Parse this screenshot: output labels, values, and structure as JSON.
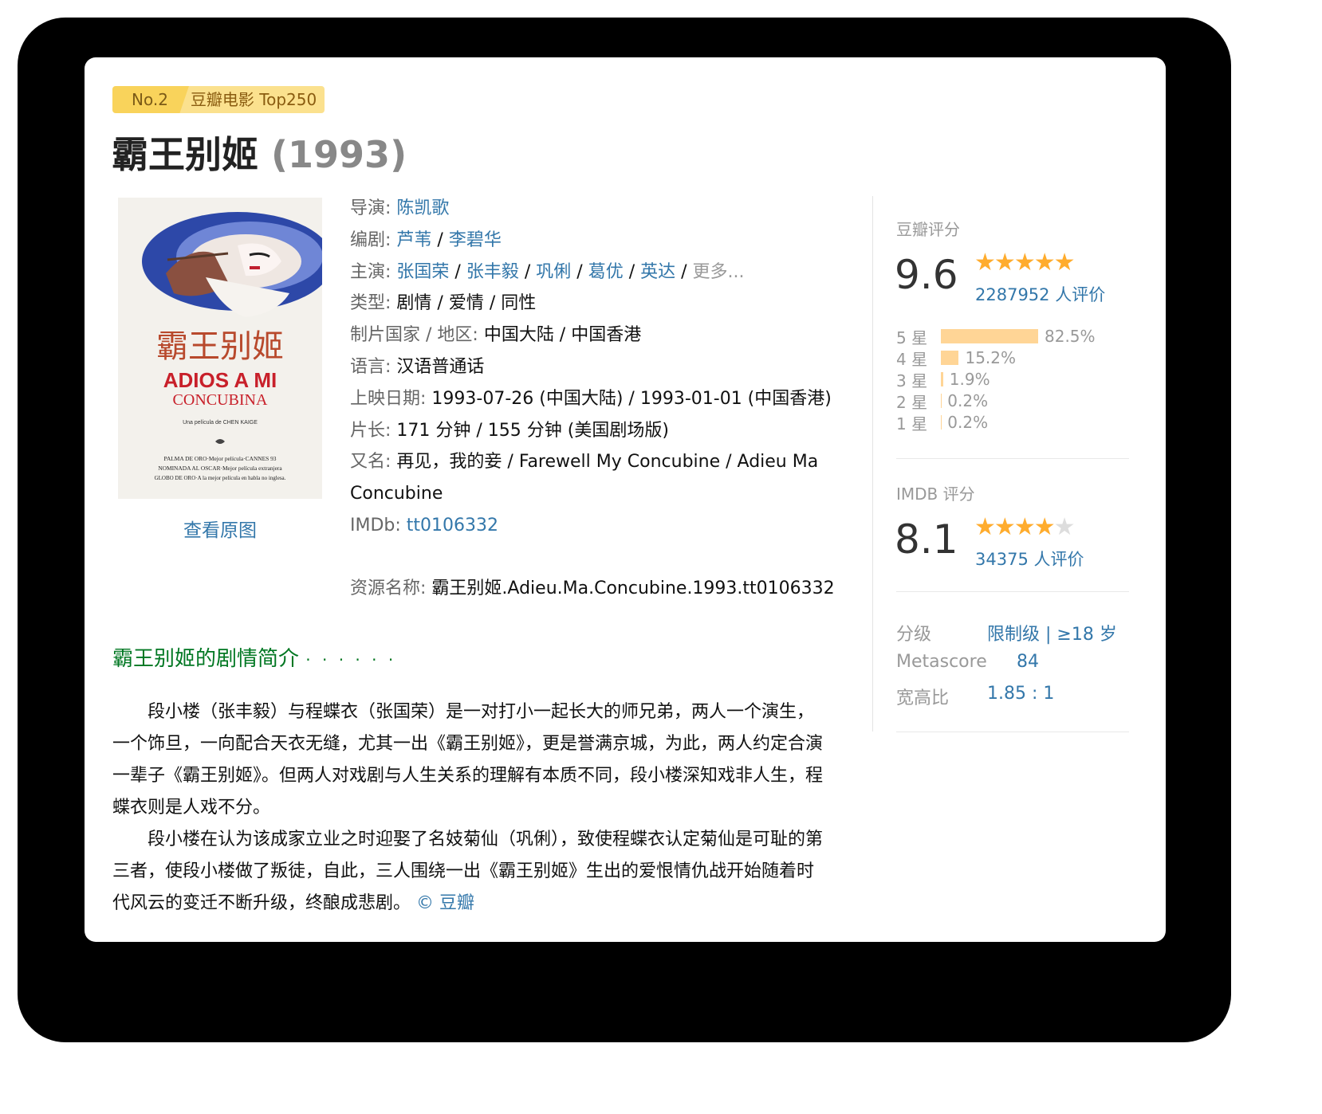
{
  "badge": {
    "rank": "No.2",
    "list": "豆瓣电影 Top250"
  },
  "title": {
    "name": "霸王别姬",
    "year": "(1993)"
  },
  "poster": {
    "chinese_title": "霸王别姬",
    "line1": "ADIOS A MI",
    "line2": "CONCUBINA",
    "credit": "Una película de CHEN KAIGE",
    "award1": "PALMA DE ORO·Mejor película·CANNES 93",
    "award2": "NOMINADA AL OSCAR·Mejor película extranjera",
    "award3": "GLOBO DE ORO·A la mejor película en habla no inglesa.",
    "view_link": "查看原图"
  },
  "info": {
    "director_label": "导演",
    "director": "陈凯歌",
    "writer_label": "编剧",
    "writers": [
      "芦苇",
      "李碧华"
    ],
    "cast_label": "主演",
    "cast": [
      "张国荣",
      "张丰毅",
      "巩俐",
      "葛优",
      "英达"
    ],
    "cast_more": "更多...",
    "genre_label": "类型",
    "genre": "剧情 / 爱情 / 同性",
    "country_label": "制片国家 / 地区",
    "country": "中国大陆 / 中国香港",
    "language_label": "语言",
    "language": "汉语普通话",
    "release_label": "上映日期",
    "release": "1993-07-26 (中国大陆) / 1993-01-01 (中国香港)",
    "runtime_label": "片长",
    "runtime": "171 分钟 / 155 分钟 (美国剧场版)",
    "aka_label": "又名",
    "aka": "再见，我的妾 / Farewell My Concubine / Adieu Ma Concubine",
    "imdb_label": "IMDb",
    "imdb_id": "tt0106332",
    "resource_label": "资源名称",
    "resource": "霸王别姬.Adieu.Ma.Concubine.1993.tt0106332"
  },
  "douban_rating": {
    "heading": "豆瓣评分",
    "score": "9.6",
    "stars": 5,
    "votes": "2287952 人评价",
    "distribution": [
      {
        "label": "5 星",
        "percent": 82.5,
        "text": "82.5%"
      },
      {
        "label": "4 星",
        "percent": 15.2,
        "text": "15.2%"
      },
      {
        "label": "3 星",
        "percent": 1.9,
        "text": "1.9%"
      },
      {
        "label": "2 星",
        "percent": 0.2,
        "text": "0.2%"
      },
      {
        "label": "1 星",
        "percent": 0.2,
        "text": "0.2%"
      }
    ]
  },
  "imdb_rating": {
    "heading": "IMDB 评分",
    "score": "8.1",
    "stars": 4,
    "votes": "34375 人评价"
  },
  "extra": {
    "rating_label": "分级",
    "rating_value": "限制级 | ≥18 岁",
    "metascore_label": "Metascore",
    "metascore_value": "84",
    "aspect_label": "宽高比",
    "aspect_value": "1.85 : 1"
  },
  "summary": {
    "heading": "霸王别姬的剧情简介",
    "dots": "· · · · · ·",
    "p1": "段小楼（张丰毅）与程蝶衣（张国荣）是一对打小一起长大的师兄弟，两人一个演生，一个饰旦，一向配合天衣无缝，尤其一出《霸王别姬》，更是誉满京城，为此，两人约定合演一辈子《霸王别姬》。但两人对戏剧与人生关系的理解有本质不同，段小楼深知戏非人生，程蝶衣则是人戏不分。",
    "p2": "段小楼在认为该成家立业之时迎娶了名妓菊仙（巩俐），致使程蝶衣认定菊仙是可耻的第三者，使段小楼做了叛徒，自此，三人围绕一出《霸王别姬》生出的爱恨情仇战开始随着时代风云的变迁不断升级，终酿成悲剧。",
    "source": "© 豆瓣"
  },
  "colors": {
    "link": "#3377aa",
    "star": "#ffac2d",
    "bar": "#ffd596",
    "section_heading": "#007722",
    "badge": "#f9d35b"
  }
}
